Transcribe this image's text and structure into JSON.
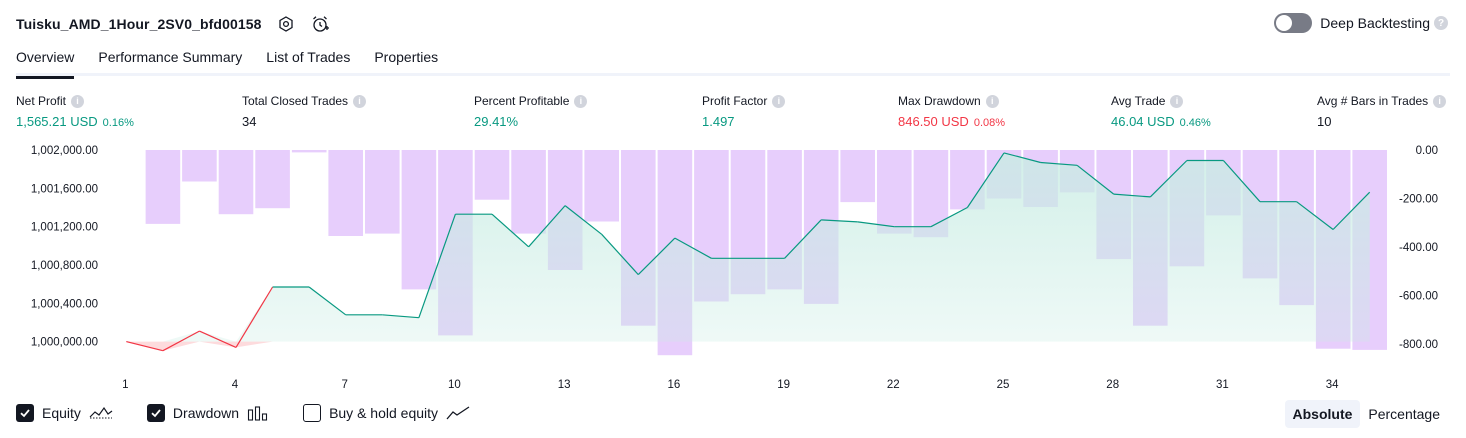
{
  "header": {
    "strategy_name": "Tuisku_AMD_1Hour_2SV0_bfd00158"
  },
  "deep_backtesting": {
    "label": "Deep Backtesting",
    "help": "?"
  },
  "tabs": [
    {
      "label": "Overview"
    },
    {
      "label": "Performance Summary"
    },
    {
      "label": "List of Trades"
    },
    {
      "label": "Properties"
    }
  ],
  "metrics": {
    "net_profit": {
      "label": "Net Profit",
      "value": "1,565.21 USD",
      "pct": "0.16%"
    },
    "total_closed_trades": {
      "label": "Total Closed Trades",
      "value": "34"
    },
    "percent_profitable": {
      "label": "Percent Profitable",
      "value": "29.41%"
    },
    "profit_factor": {
      "label": "Profit Factor",
      "value": "1.497"
    },
    "max_drawdown": {
      "label": "Max Drawdown",
      "value": "846.50 USD",
      "pct": "0.08%"
    },
    "avg_trade": {
      "label": "Avg Trade",
      "value": "46.04 USD",
      "pct": "0.46%"
    },
    "avg_bars": {
      "label": "Avg # Bars in Trades",
      "value": "10"
    }
  },
  "info_glyph": "i",
  "colors": {
    "positive": "#089981",
    "negative": "#f23645",
    "equity_line": "#089981",
    "equity_fill": "#c8ece3",
    "drawdown_bar": "#e3c6fb"
  },
  "legend": {
    "equity": {
      "label": "Equity",
      "checked": true
    },
    "drawdown": {
      "label": "Drawdown",
      "checked": true
    },
    "buy_hold": {
      "label": "Buy & hold equity",
      "checked": false
    }
  },
  "mode": {
    "absolute": "Absolute",
    "percentage": "Percentage",
    "selected": "absolute"
  },
  "chart_data": [
    {
      "type": "line",
      "name": "Equity",
      "y_axis": "left",
      "ylim": [
        999850,
        1002000
      ],
      "yticks": [
        "1,002,000.00",
        "1,001,600.00",
        "1,001,200.00",
        "1,000,800.00",
        "1,000,400.00",
        "1,000,000.00"
      ],
      "ytick_values": [
        1002000,
        1001600,
        1001200,
        1000800,
        1000400,
        1000000
      ],
      "x": [
        1,
        2,
        3,
        4,
        5,
        6,
        7,
        8,
        9,
        10,
        11,
        12,
        13,
        14,
        15,
        16,
        17,
        18,
        19,
        20,
        21,
        22,
        23,
        24,
        25,
        26,
        27,
        28,
        29,
        30,
        31,
        32,
        33,
        34,
        35
      ],
      "xticks": [
        "1",
        "4",
        "7",
        "10",
        "13",
        "16",
        "19",
        "22",
        "25",
        "28",
        "31",
        "34"
      ],
      "xtick_values": [
        1,
        4,
        7,
        10,
        13,
        16,
        19,
        22,
        25,
        28,
        31,
        34
      ],
      "values": [
        1000000,
        999905,
        1000110,
        999940,
        1000570,
        1000570,
        1000280,
        1000280,
        1000250,
        1001330,
        1001330,
        1000990,
        1001420,
        1001120,
        1000700,
        1001080,
        1000870,
        1000870,
        1000870,
        1001270,
        1001250,
        1001200,
        1001200,
        1001400,
        1001970,
        1001870,
        1001840,
        1001540,
        1001510,
        1001890,
        1001890,
        1001460,
        1001460,
        1001170,
        1001560
      ]
    },
    {
      "type": "bar",
      "name": "Drawdown",
      "y_axis": "right",
      "ylim": [
        -850,
        0
      ],
      "yticks": [
        "0.00",
        "-200.00",
        "-400.00",
        "-600.00",
        "-800.00"
      ],
      "ytick_values": [
        0,
        -200,
        -400,
        -600,
        -800
      ],
      "x": [
        1,
        2,
        3,
        4,
        5,
        6,
        7,
        8,
        9,
        10,
        11,
        12,
        13,
        14,
        15,
        16,
        17,
        18,
        19,
        20,
        21,
        22,
        23,
        24,
        25,
        26,
        27,
        28,
        29,
        30,
        31,
        32,
        33,
        34,
        35
      ],
      "values": [
        0,
        -305,
        -130,
        -265,
        -240,
        -10,
        -355,
        -345,
        -575,
        -765,
        -205,
        -345,
        -495,
        -295,
        -725,
        -846.5,
        -625,
        -595,
        -575,
        -635,
        -215,
        -345,
        -360,
        -245,
        -200,
        -235,
        -175,
        -450,
        -725,
        -480,
        -270,
        -530,
        -640,
        -820,
        -825
      ]
    }
  ]
}
